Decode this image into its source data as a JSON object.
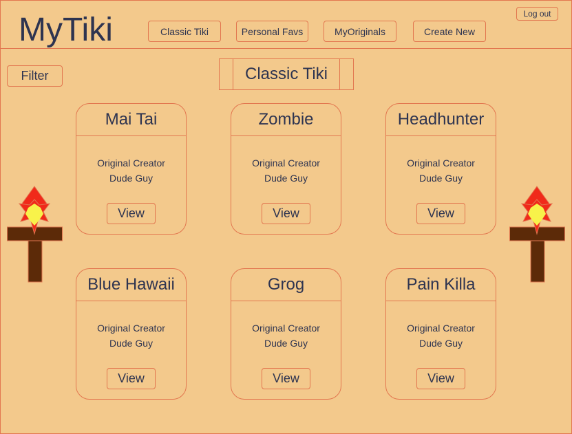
{
  "app": {
    "logo": "MyTiki"
  },
  "header": {
    "nav": [
      {
        "label": "Classic Tiki"
      },
      {
        "label": "Personal Favs"
      },
      {
        "label": "MyOriginals"
      },
      {
        "label": "Create New"
      }
    ],
    "logout_label": "Log out"
  },
  "toolbar": {
    "filter_label": "Filter"
  },
  "page": {
    "title": "Classic Tiki"
  },
  "cards": [
    {
      "title": "Mai Tai",
      "line1": "Original Creator",
      "line2": "Dude Guy",
      "button": "View"
    },
    {
      "title": "Zombie",
      "line1": "Original Creator",
      "line2": "Dude Guy",
      "button": "View"
    },
    {
      "title": "Headhunter",
      "line1": "Original Creator",
      "line2": "Dude Guy",
      "button": "View"
    },
    {
      "title": "Blue Hawaii",
      "line1": "Original Creator",
      "line2": "Dude Guy",
      "button": "View"
    },
    {
      "title": "Grog",
      "line1": "Original Creator",
      "line2": "Dude Guy",
      "button": "View"
    },
    {
      "title": "Pain Killa",
      "line1": "Original Creator",
      "line2": "Dude Guy",
      "button": "View"
    }
  ],
  "decor": {
    "left_icon": "tiki-torch-icon",
    "right_icon": "tiki-torch-icon"
  },
  "colors": {
    "background": "#f3c98c",
    "border": "#e2764f",
    "text": "#2e3450",
    "torch_pole": "#5c2a08",
    "flame_outer": "#f02a1a",
    "flame_inner": "#f8f24a"
  }
}
